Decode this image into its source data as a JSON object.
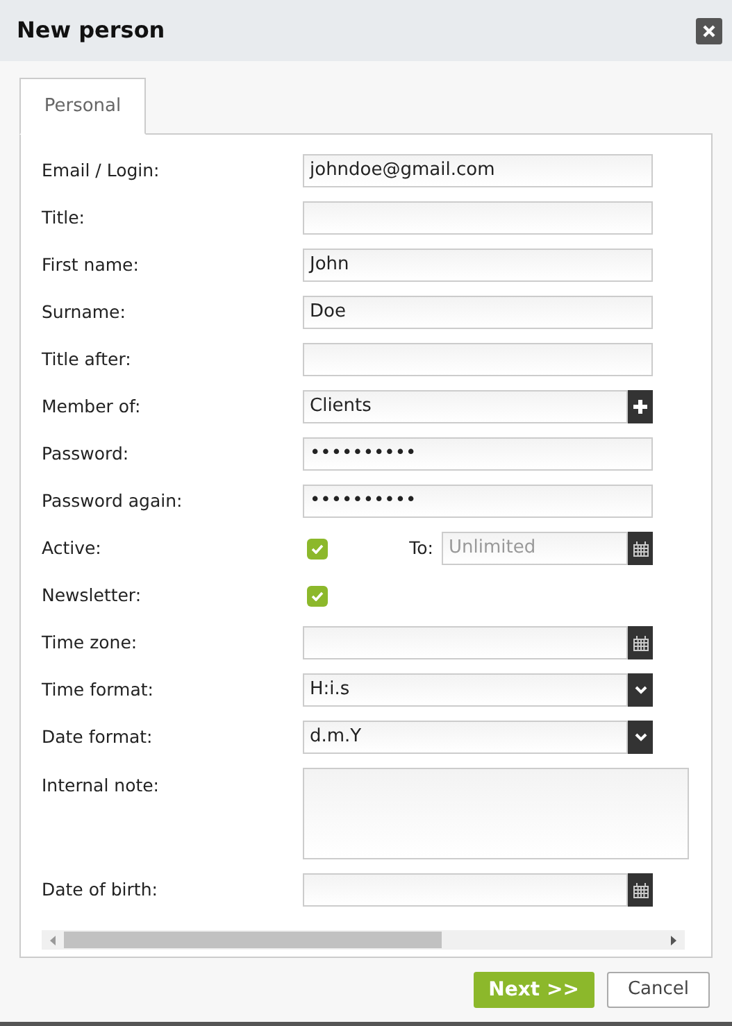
{
  "window": {
    "title": "New person"
  },
  "tabs": [
    {
      "label": "Personal",
      "selected": true
    }
  ],
  "fields": [
    {
      "label": "Email / Login:",
      "kind": "text",
      "value": "johndoe@gmail.com"
    },
    {
      "label": "Title:",
      "kind": "text"
    },
    {
      "label": "First name:",
      "kind": "text",
      "value": "John"
    },
    {
      "label": "Surname:",
      "kind": "text",
      "value": "Doe"
    },
    {
      "label": "Title after:",
      "kind": "text"
    },
    {
      "label": "Member of:",
      "kind": "add",
      "value": "Clients"
    },
    {
      "label": "Password:",
      "kind": "text",
      "value": "••••••••••"
    },
    {
      "label": "Password again:",
      "kind": "text",
      "value": "••••••••••"
    },
    {
      "label": "Active:",
      "kind": "checkbox",
      "checked": true,
      "to_label": "To:",
      "to_placeholder": "Unlimited"
    },
    {
      "label": "Newsletter:",
      "kind": "checkbox",
      "checked": true
    },
    {
      "label": "Time zone:",
      "kind": "date"
    },
    {
      "label": "Time format:",
      "kind": "select",
      "value": "H:i.s"
    },
    {
      "label": "Date format:",
      "kind": "select",
      "value": "d.m.Y"
    },
    {
      "label": "Internal note:",
      "kind": "textarea"
    },
    {
      "label": "Date of birth:",
      "kind": "date"
    }
  ],
  "buttons": [
    {
      "label": "Next >>",
      "kind": "primary"
    },
    {
      "label": "Cancel",
      "kind": "secondary"
    }
  ]
}
